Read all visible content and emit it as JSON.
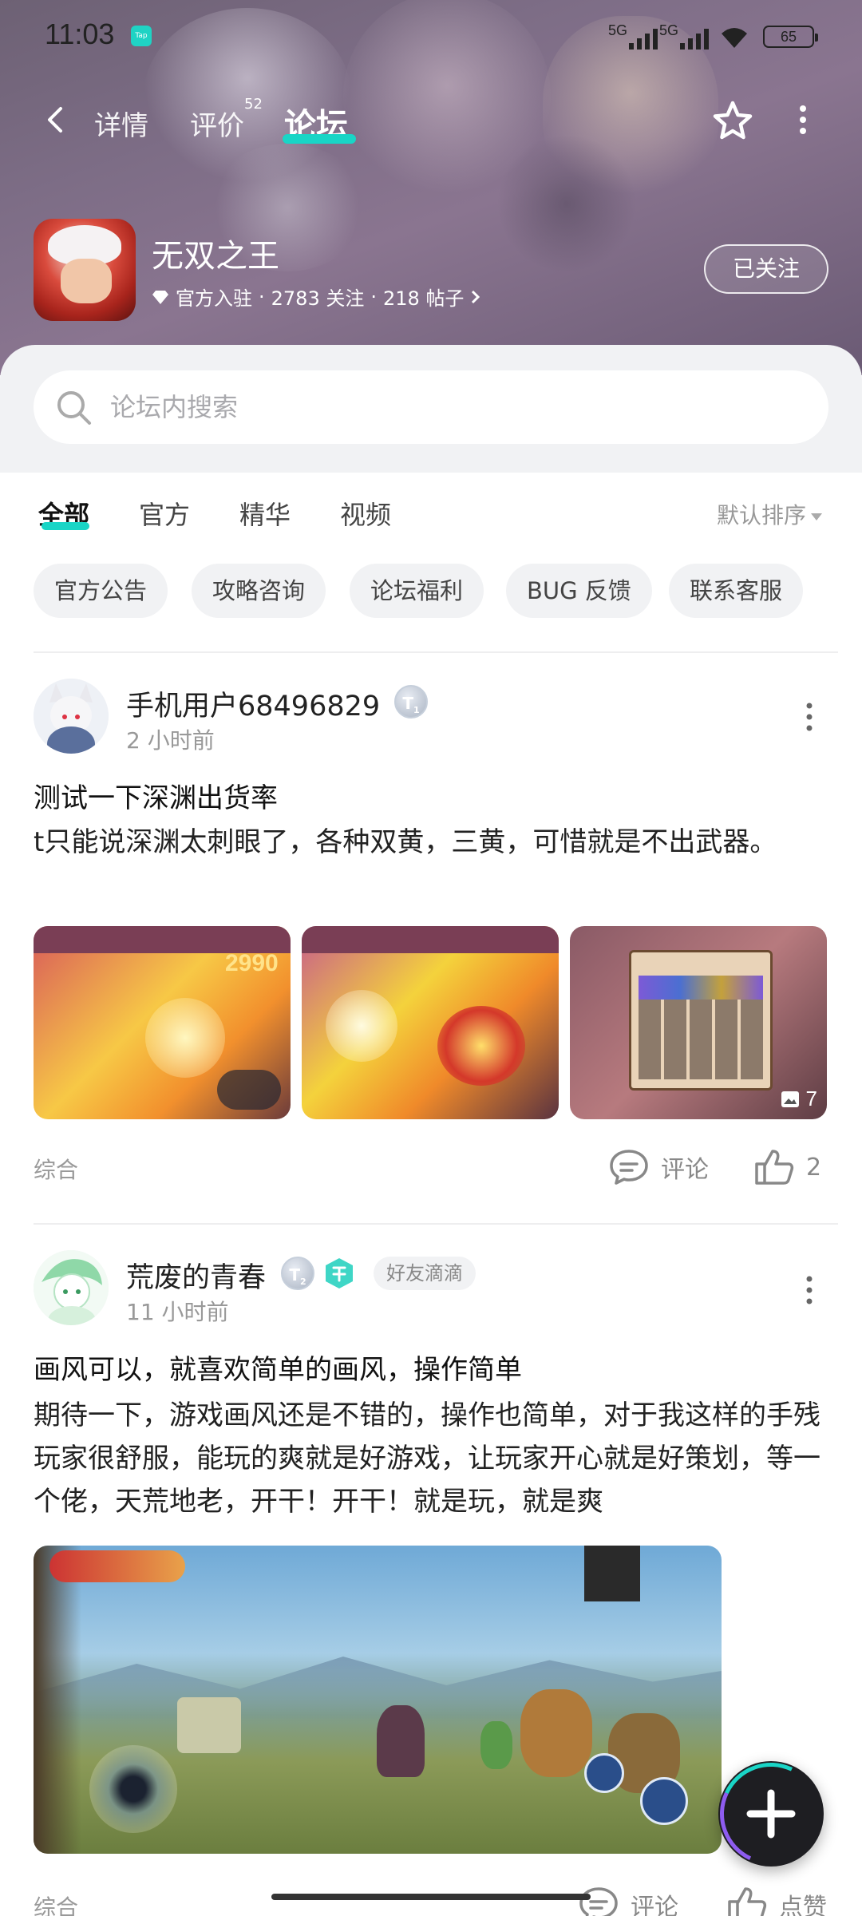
{
  "status_bar": {
    "time": "11:03",
    "app_badge": "Tap",
    "signal1": "5G",
    "signal2": "5G",
    "battery": "65"
  },
  "nav": {
    "tabs": [
      {
        "label": "详情"
      },
      {
        "label": "评价",
        "badge": "52"
      },
      {
        "label": "论坛"
      }
    ],
    "active_tab": "论坛"
  },
  "game": {
    "title": "无双之王",
    "official": "官方入驻",
    "followers": "2783 关注",
    "posts": "218 帖子",
    "sep": "·",
    "follow_label": "已关注"
  },
  "search": {
    "placeholder": "论坛内搜索"
  },
  "filters": {
    "tabs": [
      "全部",
      "官方",
      "精华",
      "视频"
    ],
    "active": "全部",
    "sort_label": "默认排序"
  },
  "chips": [
    "官方公告",
    "攻略咨询",
    "论坛福利",
    "BUG 反馈",
    "联系客服"
  ],
  "posts": [
    {
      "username": "手机用户68496829",
      "level": "T",
      "level_num": "1",
      "time": "2 小时前",
      "title": "测试一下深渊出货率",
      "body": "t只能说深渊太刺眼了，各种双黄，三黄，可惜就是不出武器。",
      "thumb1_text": "2990",
      "image_count": "7",
      "category": "综合",
      "comment_label": "评论",
      "like_count": "2"
    },
    {
      "username": "荒废的青春",
      "level": "T",
      "level_num": "2",
      "tag": "好友滴滴",
      "time": "11 小时前",
      "title": "画风可以，就喜欢简单的画风，操作简单",
      "body": "期待一下，游戏画风还是不错的，操作也简单，对于我这样的手残玩家很舒服，能玩的爽就是好游戏，让玩家开心就是好策划，等一个佬，天荒地老，开干！开干！就是玩，就是爽",
      "category": "综合",
      "comment_label": "评论",
      "like_label": "点赞"
    }
  ],
  "colors": {
    "accent": "#19d5c6",
    "banner": "#7d6d86"
  }
}
